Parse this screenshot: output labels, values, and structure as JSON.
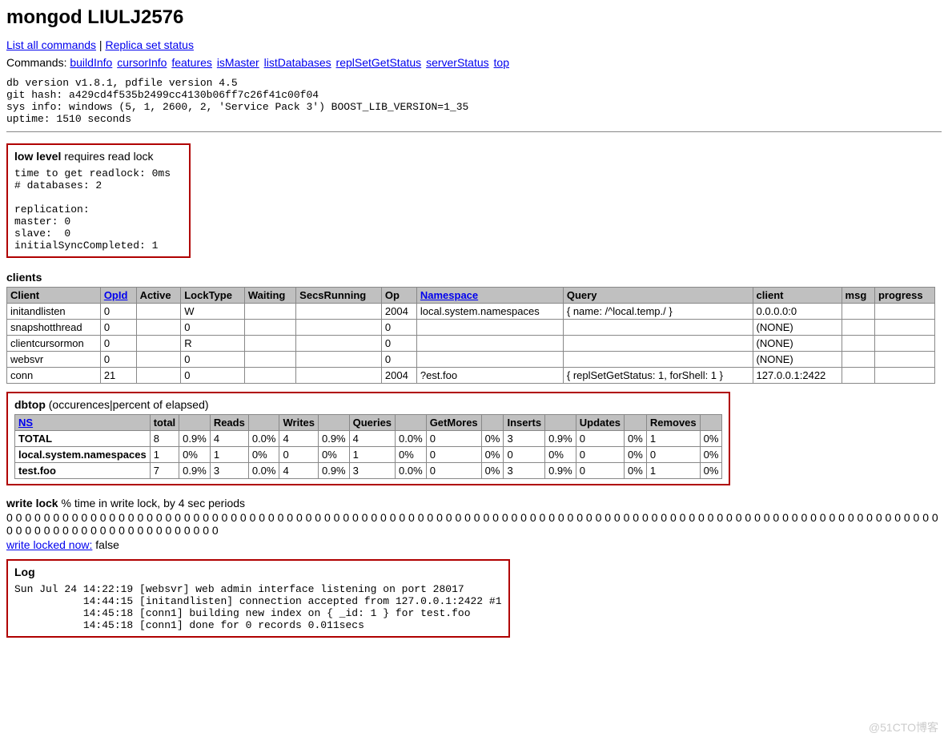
{
  "title": "mongod LIULJ2576",
  "nav": {
    "list_all": "List all commands",
    "sep": " | ",
    "replica": "Replica set status"
  },
  "commands_label": "Commands: ",
  "commands": [
    "buildInfo",
    "cursorInfo",
    "features",
    "isMaster",
    "listDatabases",
    "replSetGetStatus",
    "serverStatus",
    "top"
  ],
  "sysinfo": "db version v1.8.1, pdfile version 4.5\ngit hash: a429cd4f535b2499cc4130b06ff7c26f41c00f04\nsys info: windows (5, 1, 2600, 2, 'Service Pack 3') BOOST_LIB_VERSION=1_35\nuptime: 1510 seconds",
  "lowlevel": {
    "heading_bold": "low level",
    "heading_rest": " requires read lock",
    "body": "time to get readlock: 0ms\n# databases: 2\n\nreplication:\nmaster: 0\nslave:  0\ninitialSyncCompleted: 1"
  },
  "clients": {
    "title": "clients",
    "headers": [
      "Client",
      "OpId",
      "Active",
      "LockType",
      "Waiting",
      "SecsRunning",
      "Op",
      "Namespace",
      "Query",
      "client",
      "msg",
      "progress"
    ],
    "link_header_indices": [
      1,
      7
    ],
    "rows": [
      [
        "initandlisten",
        "0",
        "",
        "W",
        "",
        "",
        "2004",
        "local.system.namespaces",
        "{ name: /^local.temp./ }",
        "0.0.0.0:0",
        "",
        ""
      ],
      [
        "snapshotthread",
        "0",
        "",
        "0",
        "",
        "",
        "0",
        "",
        "",
        "(NONE)",
        "",
        ""
      ],
      [
        "clientcursormon",
        "0",
        "",
        "R",
        "",
        "",
        "0",
        "",
        "",
        "(NONE)",
        "",
        ""
      ],
      [
        "websvr",
        "0",
        "",
        "0",
        "",
        "",
        "0",
        "",
        "",
        "(NONE)",
        "",
        ""
      ],
      [
        "conn",
        "21",
        "",
        "0",
        "",
        "",
        "2004",
        "?est.foo",
        "{ replSetGetStatus: 1, forShell: 1 }",
        "127.0.0.1:2422",
        "",
        ""
      ]
    ]
  },
  "dbtop": {
    "title_bold": "dbtop",
    "title_rest": " (occurences|percent of elapsed)",
    "headers": [
      "NS",
      "total",
      "",
      "Reads",
      "",
      "Writes",
      "",
      "Queries",
      "",
      "GetMores",
      "",
      "Inserts",
      "",
      "Updates",
      "",
      "Removes",
      ""
    ],
    "link_header_indices": [
      0
    ],
    "rows": [
      [
        "TOTAL",
        "8",
        "0.9%",
        "4",
        "0.0%",
        "4",
        "0.9%",
        "4",
        "0.0%",
        "0",
        "0%",
        "3",
        "0.9%",
        "0",
        "0%",
        "1",
        "0%"
      ],
      [
        "local.system.namespaces",
        "1",
        "0%",
        "1",
        "0%",
        "0",
        "0%",
        "1",
        "0%",
        "0",
        "0%",
        "0",
        "0%",
        "0",
        "0%",
        "0",
        "0%"
      ],
      [
        "test.foo",
        "7",
        "0.9%",
        "3",
        "0.0%",
        "4",
        "0.9%",
        "3",
        "0.0%",
        "0",
        "0%",
        "3",
        "0.9%",
        "0",
        "0%",
        "1",
        "0%"
      ]
    ]
  },
  "writelock": {
    "title_bold": "write lock",
    "title_rest": " % time in write lock, by 4 sec periods",
    "zeros": "0 0 0 0 0 0 0 0 0 0 0 0 0 0 0 0 0 0 0 0 0 0 0 0 0 0 0 0 0 0 0 0 0 0 0 0 0 0 0 0 0 0 0 0 0 0 0 0 0 0 0 0 0 0 0 0 0 0 0 0 0 0 0 0 0 0 0 0 0 0 0 0 0 0 0 0 0 0 0 0 0 0 0 0 0 0 0 0 0 0 0 0 0 0 0 0 0 0 0 0 0 0 0 0 0 0 0 0 0 0 0 0 0 0 0 0 0 0 0 0 0 0 0",
    "locked_label": "write locked now:",
    "locked_value": " false"
  },
  "log": {
    "title": "Log",
    "body": "Sun Jul 24 14:22:19 [websvr] web admin interface listening on port 28017\n           14:44:15 [initandlisten] connection accepted from 127.0.0.1:2422 #1\n           14:45:18 [conn1] building new index on { _id: 1 } for test.foo\n           14:45:18 [conn1] done for 0 records 0.011secs"
  },
  "watermark": "@51CTO博客"
}
